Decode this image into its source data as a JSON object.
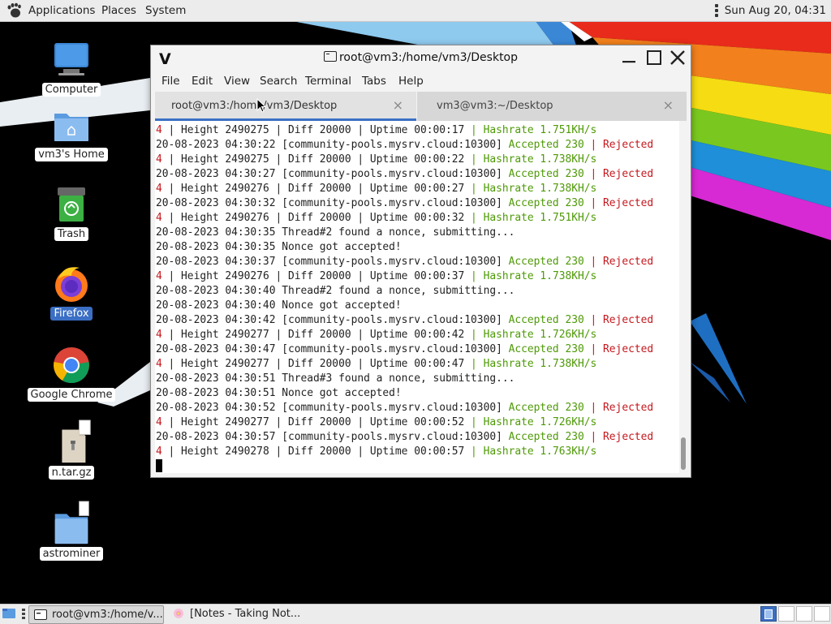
{
  "top_panel": {
    "applications": "Applications",
    "places": "Places",
    "system": "System",
    "clock": "Sun Aug 20, 04:31",
    "apps_icon": "gnome-foot-icon"
  },
  "desktop": {
    "icons": [
      {
        "label": "Computer",
        "icon": "monitor-icon"
      },
      {
        "label": "vm3's Home",
        "icon": "home-folder-icon"
      },
      {
        "label": "Trash",
        "icon": "trash-icon"
      },
      {
        "label": "Firefox",
        "icon": "firefox-icon",
        "selected": true
      },
      {
        "label": "Google Chrome",
        "icon": "chrome-icon"
      },
      {
        "label": "n.tar.gz",
        "icon": "archive-icon"
      },
      {
        "label": "astrominer",
        "icon": "folder-icon"
      }
    ]
  },
  "terminal": {
    "title": "root@vm3:/home/vm3/Desktop",
    "menu": [
      "File",
      "Edit",
      "View",
      "Search",
      "Terminal",
      "Tabs",
      "Help"
    ],
    "tabs": [
      {
        "label": "root@vm3:/home/vm3/Desktop",
        "active": true
      },
      {
        "label": "vm3@vm3:~/Desktop",
        "active": false
      }
    ],
    "tab_close": "×",
    "lines": [
      [
        [
          "r",
          "4"
        ],
        [
          "n",
          " | Height 2490275 | Diff 20000 | Uptime 00:00:17 "
        ],
        [
          "g",
          "| Hashrate 1.751KH/s"
        ]
      ],
      [
        [
          "n",
          "20-08-2023 04:30:22 [community-pools.mysrv.cloud:10300] "
        ],
        [
          "g",
          "Accepted 230 "
        ],
        [
          "r",
          "| Rejected"
        ]
      ],
      [
        [
          "r",
          "4"
        ],
        [
          "n",
          " | Height 2490275 | Diff 20000 | Uptime 00:00:22 "
        ],
        [
          "g",
          "| Hashrate 1.738KH/s"
        ]
      ],
      [
        [
          "n",
          "20-08-2023 04:30:27 [community-pools.mysrv.cloud:10300] "
        ],
        [
          "g",
          "Accepted 230 "
        ],
        [
          "r",
          "| Rejected"
        ]
      ],
      [
        [
          "r",
          "4"
        ],
        [
          "n",
          " | Height 2490276 | Diff 20000 | Uptime 00:00:27 "
        ],
        [
          "g",
          "| Hashrate 1.738KH/s"
        ]
      ],
      [
        [
          "n",
          "20-08-2023 04:30:32 [community-pools.mysrv.cloud:10300] "
        ],
        [
          "g",
          "Accepted 230 "
        ],
        [
          "r",
          "| Rejected"
        ]
      ],
      [
        [
          "r",
          "4"
        ],
        [
          "n",
          " | Height 2490276 | Diff 20000 | Uptime 00:00:32 "
        ],
        [
          "g",
          "| Hashrate 1.751KH/s"
        ]
      ],
      [
        [
          "n",
          "20-08-2023 04:30:35 Thread#2 found a nonce, submitting..."
        ]
      ],
      [
        [
          "n",
          "20-08-2023 04:30:35 Nonce got accepted!"
        ]
      ],
      [
        [
          "n",
          "20-08-2023 04:30:37 [community-pools.mysrv.cloud:10300] "
        ],
        [
          "g",
          "Accepted 230 "
        ],
        [
          "r",
          "| Rejected"
        ]
      ],
      [
        [
          "r",
          "4"
        ],
        [
          "n",
          " | Height 2490276 | Diff 20000 | Uptime 00:00:37 "
        ],
        [
          "g",
          "| Hashrate 1.738KH/s"
        ]
      ],
      [
        [
          "n",
          "20-08-2023 04:30:40 Thread#2 found a nonce, submitting..."
        ]
      ],
      [
        [
          "n",
          "20-08-2023 04:30:40 Nonce got accepted!"
        ]
      ],
      [
        [
          "n",
          "20-08-2023 04:30:42 [community-pools.mysrv.cloud:10300] "
        ],
        [
          "g",
          "Accepted 230 "
        ],
        [
          "r",
          "| Rejected"
        ]
      ],
      [
        [
          "r",
          "4"
        ],
        [
          "n",
          " | Height 2490277 | Diff 20000 | Uptime 00:00:42 "
        ],
        [
          "g",
          "| Hashrate 1.726KH/s"
        ]
      ],
      [
        [
          "n",
          "20-08-2023 04:30:47 [community-pools.mysrv.cloud:10300] "
        ],
        [
          "g",
          "Accepted 230 "
        ],
        [
          "r",
          "| Rejected"
        ]
      ],
      [
        [
          "r",
          "4"
        ],
        [
          "n",
          " | Height 2490277 | Diff 20000 | Uptime 00:00:47 "
        ],
        [
          "g",
          "| Hashrate 1.738KH/s"
        ]
      ],
      [
        [
          "n",
          "20-08-2023 04:30:51 Thread#3 found a nonce, submitting..."
        ]
      ],
      [
        [
          "n",
          "20-08-2023 04:30:51 Nonce got accepted!"
        ]
      ],
      [
        [
          "n",
          "20-08-2023 04:30:52 [community-pools.mysrv.cloud:10300] "
        ],
        [
          "g",
          "Accepted 230 "
        ],
        [
          "r",
          "| Rejected"
        ]
      ],
      [
        [
          "r",
          "4"
        ],
        [
          "n",
          " | Height 2490277 | Diff 20000 | Uptime 00:00:52 "
        ],
        [
          "g",
          "| Hashrate 1.726KH/s"
        ]
      ],
      [
        [
          "n",
          "20-08-2023 04:30:57 [community-pools.mysrv.cloud:10300] "
        ],
        [
          "g",
          "Accepted 230 "
        ],
        [
          "r",
          "| Rejected"
        ]
      ],
      [
        [
          "r",
          "4"
        ],
        [
          "n",
          " | Height 2490278 | Diff 20000 | Uptime 00:00:57 "
        ],
        [
          "g",
          "| Hashrate 1.763KH/s"
        ]
      ]
    ]
  },
  "taskbar": {
    "tasks": [
      {
        "label": "root@vm3:/home/v...",
        "icon": "terminal-icon",
        "active": true
      },
      {
        "label": "[Notes - Taking Not...",
        "icon": "notes-icon",
        "active": false
      }
    ],
    "workspaces": 4
  },
  "colors": {
    "green": "#4e9a06",
    "red": "#c4161c",
    "accent": "#3b6fc4"
  }
}
